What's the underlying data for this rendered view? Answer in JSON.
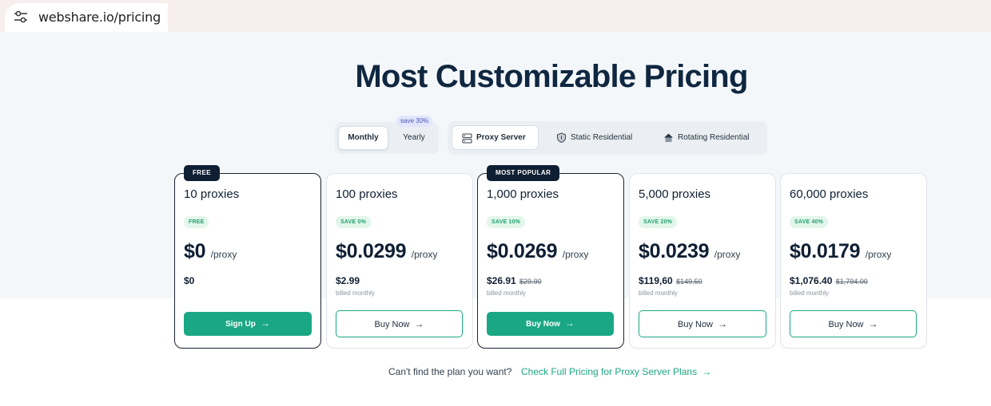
{
  "browser": {
    "url": "webshare.io/pricing",
    "site_settings_icon": "tune-icon"
  },
  "hero": {
    "title": "Most Customizable Pricing"
  },
  "billing_toggle": {
    "options": [
      "Monthly",
      "Yearly"
    ],
    "selected": "Monthly",
    "yearly_badge": "save 30%"
  },
  "proxy_types": {
    "options": [
      {
        "label": "Proxy Server",
        "icon": "server-icon"
      },
      {
        "label": "Static Residential",
        "icon": "shield-icon"
      },
      {
        "label": "Rotating Residential",
        "icon": "house-icon"
      }
    ],
    "selected": "Proxy Server"
  },
  "plans": [
    {
      "tag": "FREE",
      "name": "10 proxies",
      "save": "FREE",
      "price": "$0",
      "unit": "/proxy",
      "billed": "$0",
      "billed_old": "",
      "billed_note": "",
      "cta": "Sign Up"
    },
    {
      "tag": "",
      "name": "100 proxies",
      "save": "SAVE 0%",
      "price": "$0.0299",
      "unit": "/proxy",
      "billed": "$2.99",
      "billed_old": "",
      "billed_note": "billed monthly",
      "cta": "Buy Now"
    },
    {
      "tag": "MOST POPULAR",
      "name": "1,000 proxies",
      "save": "SAVE 10%",
      "price": "$0.0269",
      "unit": "/proxy",
      "billed": "$26.91",
      "billed_old": "$29.90",
      "billed_note": "billed monthly",
      "cta": "Buy Now"
    },
    {
      "tag": "",
      "name": "5,000 proxies",
      "save": "SAVE 20%",
      "price": "$0.0239",
      "unit": "/proxy",
      "billed": "$119,60",
      "billed_old": "$149.50",
      "billed_note": "billed monthly",
      "cta": "Buy Now"
    },
    {
      "tag": "",
      "name": "60,000 proxies",
      "save": "SAVE 40%",
      "price": "$0.0179",
      "unit": "/proxy",
      "billed": "$1,076.40",
      "billed_old": "$1,794.00",
      "billed_note": "billed monthly",
      "cta": "Buy Now"
    }
  ],
  "footer": {
    "question": "Can't find the plan you want?",
    "link": "Check Full Pricing for Proxy Server Plans"
  },
  "colors": {
    "accent": "#1aa784",
    "dark": "#0f1f33",
    "save_green": "#1fa36b"
  }
}
